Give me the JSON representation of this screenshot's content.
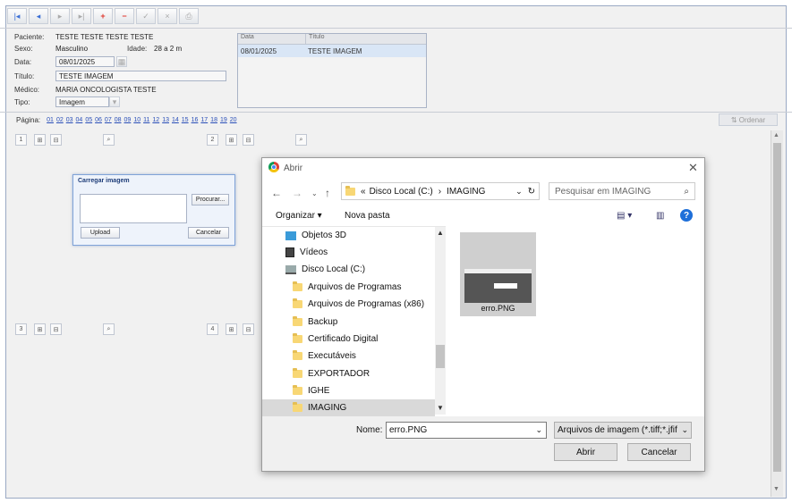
{
  "form": {
    "paciente_label": "Paciente:",
    "paciente_value": "TESTE TESTE TESTE TESTE",
    "sexo_label": "Sexo:",
    "sexo_value": "Masculino",
    "idade_label": "Idade:",
    "idade_value": "28 a 2 m",
    "data_label": "Data:",
    "data_value": "08/01/2025",
    "titulo_label": "Título:",
    "titulo_value": "TESTE IMAGEM",
    "medico_label": "Médico:",
    "medico_value": "MARIA ONCOLOGISTA TESTE",
    "tipo_label": "Tipo:",
    "tipo_value": "Imagem"
  },
  "exam_table": {
    "headers": [
      "Data",
      "Título"
    ],
    "rows": [
      [
        "08/01/2025",
        "TESTE IMAGEM"
      ]
    ]
  },
  "pager": {
    "label": "Página:",
    "pages": [
      "01",
      "02",
      "03",
      "04",
      "05",
      "06",
      "07",
      "08",
      "09",
      "10",
      "11",
      "12",
      "13",
      "14",
      "15",
      "16",
      "17",
      "18",
      "19",
      "20"
    ]
  },
  "ordenar_label": "⇅ Ordenar",
  "slots": [
    "1",
    "2",
    "3",
    "4"
  ],
  "upload_dialog": {
    "title": "Carregar imagem",
    "browse": "Procurar...",
    "upload": "Upload",
    "cancel": "Cancelar"
  },
  "file_dialog": {
    "title": "Abrir",
    "path_prefix": "«",
    "path_1": "Disco Local (C:)",
    "path_sep": "›",
    "path_2": "IMAGING",
    "search_placeholder": "Pesquisar em IMAGING",
    "organize": "Organizar ▾",
    "new_folder": "Nova pasta",
    "tree": [
      {
        "label": "Objetos 3D",
        "icon": "cube-icon"
      },
      {
        "label": "Vídeos",
        "icon": "video-icon"
      },
      {
        "label": "Disco Local (C:)",
        "icon": "drive-icon"
      },
      {
        "label": "Arquivos de Programas",
        "icon": "folder-icon"
      },
      {
        "label": "Arquivos de Programas (x86)",
        "icon": "folder-icon"
      },
      {
        "label": "Backup",
        "icon": "folder-icon"
      },
      {
        "label": "Certificado Digital",
        "icon": "folder-icon"
      },
      {
        "label": "Executáveis",
        "icon": "folder-icon"
      },
      {
        "label": "EXPORTADOR",
        "icon": "folder-icon"
      },
      {
        "label": "IGHE",
        "icon": "folder-icon"
      },
      {
        "label": "IMAGING",
        "icon": "folder-icon"
      }
    ],
    "file_name_label": "Nome:",
    "file_name_value": "erro.PNG",
    "file_type": "Arquivos de imagem (*.tiff;*.jfif",
    "file_item": "erro.PNG",
    "open": "Abrir",
    "cancel": "Cancelar"
  },
  "colors": {
    "accent": "#2a4fb8",
    "selection": "#d9e6f6"
  }
}
